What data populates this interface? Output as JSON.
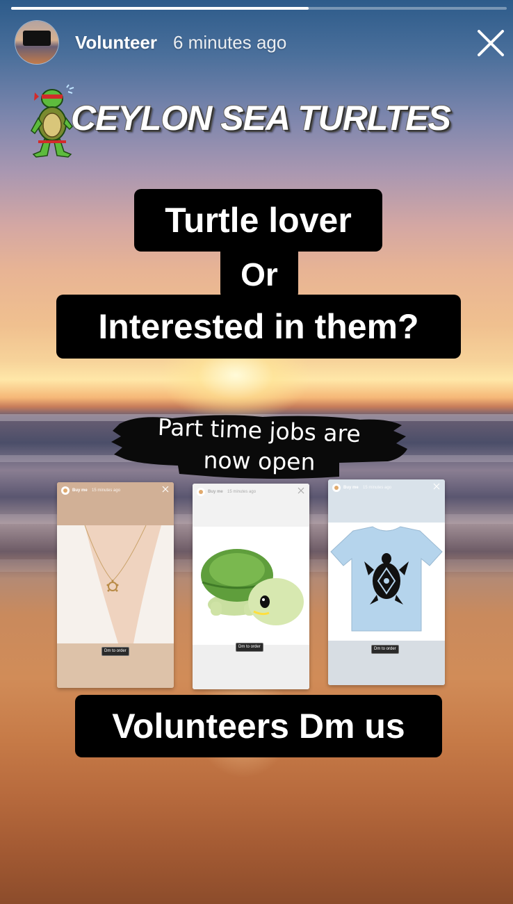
{
  "story": {
    "progress_fraction": 0.6,
    "account_name": "Volunteer",
    "timestamp": "6 minutes ago",
    "close_icon": "close-icon"
  },
  "banner": {
    "title": "CEYLON SEA TURLTES",
    "sticker_icon": "ninja-turtle-sticker"
  },
  "headline": {
    "line1": "Turtle lover",
    "line2": "Or",
    "line3": "Interested in them?"
  },
  "jobs": {
    "line1": "Part time jobs are",
    "line2": "now open"
  },
  "products": [
    {
      "name": "Buy me",
      "time": "15 minutes ago",
      "item_icon": "necklace",
      "button": "Dm to order"
    },
    {
      "name": "Buy me",
      "time": "15 minutes ago",
      "item_icon": "turtle-plush",
      "button": "Dm to order"
    },
    {
      "name": "Buy me",
      "time": "15 minutes ago",
      "item_icon": "turtle-tshirt",
      "button": "Dm to order"
    }
  ],
  "cta": {
    "label": "Volunteers Dm us"
  },
  "colors": {
    "chip_background": "#000000",
    "text": "#ffffff"
  }
}
